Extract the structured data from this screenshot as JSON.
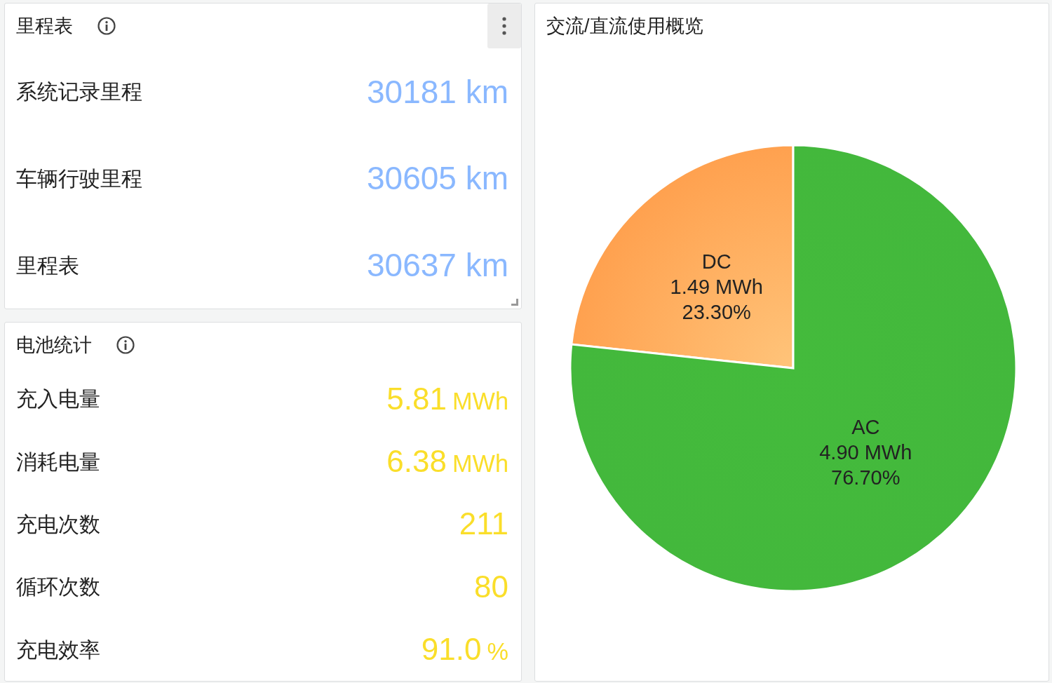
{
  "panels": [
    {
      "title": "里程表",
      "info": true,
      "menu": true,
      "resizable": true,
      "color": "#8ab8ff",
      "stats": [
        {
          "label": "系统记录里程",
          "value": "30181",
          "unit": "km"
        },
        {
          "label": "车辆行驶里程",
          "value": "30605",
          "unit": "km"
        },
        {
          "label": "里程表",
          "value": "30637",
          "unit": "km"
        }
      ]
    },
    {
      "title": "电池统计",
      "info": true,
      "menu": false,
      "resizable": false,
      "color": "#fade2a",
      "stats": [
        {
          "label": "充入电量",
          "value": "5.81",
          "unit": "MWh"
        },
        {
          "label": "消耗电量",
          "value": "6.38",
          "unit": "MWh"
        },
        {
          "label": "充电次数",
          "value": "211"
        },
        {
          "label": "循环次数",
          "value": "80"
        },
        {
          "label": "充电效率",
          "value": "91.0",
          "unit": "%"
        }
      ]
    }
  ],
  "chart_panel": {
    "title": "交流/直流使用概览",
    "chart_data": {
      "type": "pie",
      "categories": [
        "DC",
        "AC"
      ],
      "series": [
        {
          "values": [
            23.3,
            76.7
          ]
        }
      ],
      "colors": [
        "#ffa14f",
        "#43b83c"
      ],
      "value_labels": [
        [
          "1.49 MWh",
          "23.30%"
        ],
        [
          "4.90 MWh",
          "76.70%"
        ]
      ]
    }
  }
}
